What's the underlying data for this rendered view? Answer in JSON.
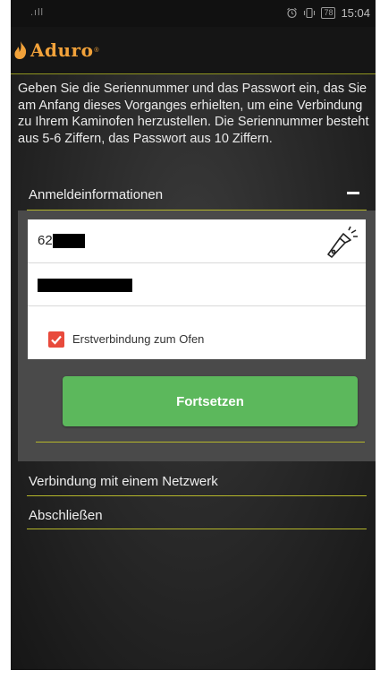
{
  "status_bar": {
    "signal": ".ıll",
    "time": "15:04",
    "battery": "78"
  },
  "app": {
    "logo_text": "Aduro",
    "logo_reg": "®"
  },
  "intro_text": "Geben Sie die Seriennummer und das Passwort ein, das Sie am Anfang dieses Vorganges erhielten, um eine Verbindung zu Ihrem Kaminofen herzustellen. Die Seriennummer besteht aus 5-6 Ziffern, das Passwort aus 10 Ziffern.",
  "login_section": {
    "title": "Anmeldeinformationen",
    "serial_value_visible": "62",
    "first_connection_label": "Erstverbindung zum Ofen",
    "first_connection_checked": true,
    "continue_label": "Fortsetzen"
  },
  "network_section": {
    "title": "Verbindung mit einem Netzwerk"
  },
  "finish_section": {
    "title": "Abschließen"
  },
  "colors": {
    "accent_line": "#b5b72a",
    "button_green": "#5cb85c",
    "checkbox_red": "#e84a3c",
    "logo_orange": "#f2a23a"
  }
}
